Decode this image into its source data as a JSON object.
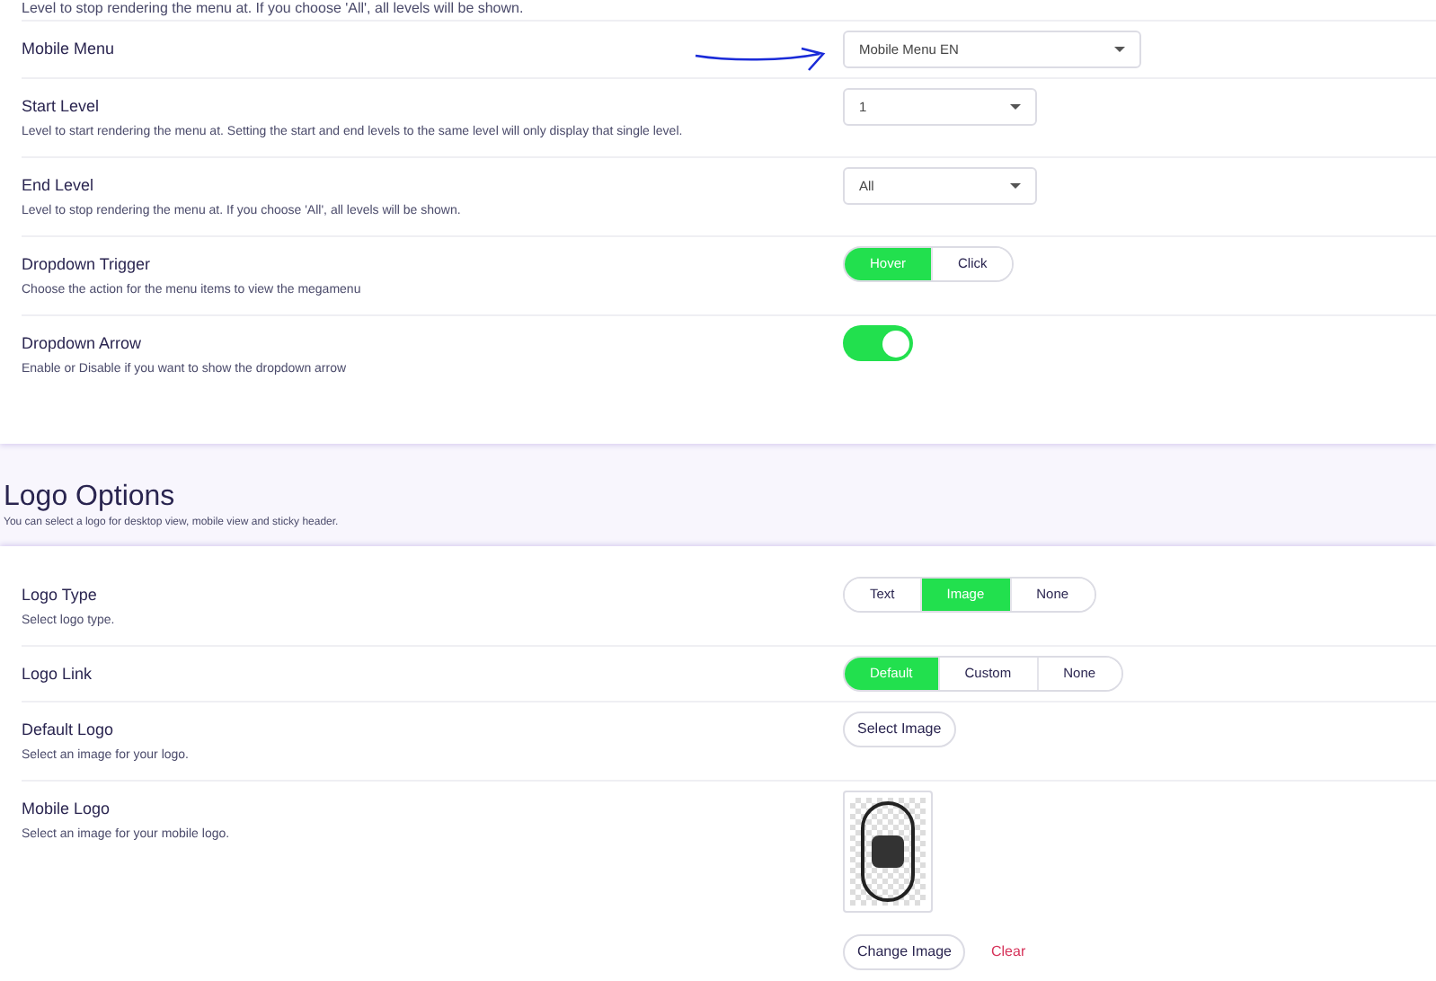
{
  "top_cut_text": "Level to stop rendering the menu at. If you choose 'All', all levels will be shown.",
  "menu_settings": [
    {
      "kind": "select",
      "label": "Mobile Menu",
      "value": "Mobile Menu EN",
      "wide": true,
      "annotated": true
    },
    {
      "kind": "select",
      "label": "Start Level",
      "description": "Level to start rendering the menu at. Setting the start and end levels to the same level will only display that single level.",
      "value": "1",
      "wide": false
    },
    {
      "kind": "select",
      "label": "End Level",
      "description": "Level to stop rendering the menu at. If you choose 'All', all levels will be shown.",
      "value": "All",
      "wide": false
    },
    {
      "kind": "segmented",
      "label": "Dropdown Trigger",
      "description": "Choose the action for the menu items to view the megamenu",
      "options": [
        {
          "label": "Hover",
          "selected": true
        },
        {
          "label": "Click",
          "selected": false
        }
      ]
    },
    {
      "kind": "toggle",
      "label": "Dropdown Arrow",
      "description": "Enable or Disable if you want to show the dropdown arrow",
      "on": true
    }
  ],
  "logo_section": {
    "title": "Logo Options",
    "subtitle": "You can select a logo for desktop view, mobile view and sticky header."
  },
  "logo_settings": [
    {
      "kind": "segmented",
      "label": "Logo Type",
      "description": "Select logo type.",
      "options": [
        {
          "label": "Text",
          "selected": false
        },
        {
          "label": "Image",
          "selected": true
        },
        {
          "label": "None",
          "selected": false
        }
      ]
    },
    {
      "kind": "segmented",
      "label": "Logo Link",
      "options": [
        {
          "label": "Default",
          "selected": true
        },
        {
          "label": "Custom",
          "selected": false
        },
        {
          "label": "None",
          "selected": false
        }
      ]
    },
    {
      "kind": "image_button",
      "label": "Default Logo",
      "description": "Select an image for your logo.",
      "button": "Select Image"
    },
    {
      "kind": "logo_image",
      "label": "Mobile Logo",
      "description": "Select an image for your mobile logo.",
      "button": "Change Image",
      "clear": "Clear"
    }
  ]
}
